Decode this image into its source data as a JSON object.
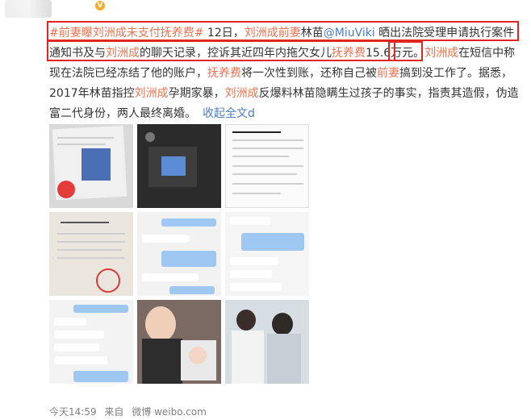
{
  "post": {
    "verified_badge": "V",
    "segments": [
      {
        "text": "#前妻曝刘洲成未支付抚养费#",
        "style": "tag"
      },
      {
        "text": " 12日，",
        "style": "plain"
      },
      {
        "text": "刘洲成",
        "style": "hl"
      },
      {
        "text": "前妻",
        "style": "hl"
      },
      {
        "text": "林苗",
        "style": "plain"
      },
      {
        "text": "@MiuViki",
        "style": "at"
      },
      {
        "text": " 晒出法院受理申请执行案件通知书及与",
        "style": "plain"
      },
      {
        "text": "刘洲成",
        "style": "hl"
      },
      {
        "text": "的聊天记录，控诉其近四年内拖欠女儿",
        "style": "plain"
      },
      {
        "text": "抚养费",
        "style": "hl"
      },
      {
        "text": "15.6万元。",
        "style": "plain"
      },
      {
        "text": "刘洲成",
        "style": "hl"
      },
      {
        "text": "在短信中称现在法院已经冻结了他的账户，",
        "style": "plain"
      },
      {
        "text": "抚养费",
        "style": "hl"
      },
      {
        "text": "将一次性到账，还称自己被",
        "style": "plain"
      },
      {
        "text": "前妻",
        "style": "hl"
      },
      {
        "text": "搞到没工作了。据悉，2017年林苗指控",
        "style": "plain"
      },
      {
        "text": "刘洲成",
        "style": "hl"
      },
      {
        "text": "孕期家暴，",
        "style": "plain"
      },
      {
        "text": "刘洲成",
        "style": "hl"
      },
      {
        "text": "反爆料林苗隐瞒生过孩子的事实，指责其造假，伪造富二代身份，两人最终离婚。",
        "style": "plain"
      },
      {
        "text": "收起全文",
        "style": "collapse"
      },
      {
        "text": "d",
        "style": "collapse"
      }
    ]
  },
  "images": [
    {
      "name": "image-notice-photo"
    },
    {
      "name": "image-phone-screenshot"
    },
    {
      "name": "image-court-document"
    },
    {
      "name": "image-court-letter"
    },
    {
      "name": "image-chat-1"
    },
    {
      "name": "image-chat-2"
    },
    {
      "name": "image-chat-3"
    },
    {
      "name": "image-father-baby-photo"
    },
    {
      "name": "image-couple-photo"
    }
  ],
  "footer": {
    "time": "今天14:59",
    "source_label": "来自",
    "source_name": "微博 weibo.com"
  },
  "colors": {
    "highlight": "#eb7350",
    "link": "#4b7dbf",
    "red_box": "#e0261f",
    "text": "#333333",
    "footer": "#808080"
  }
}
